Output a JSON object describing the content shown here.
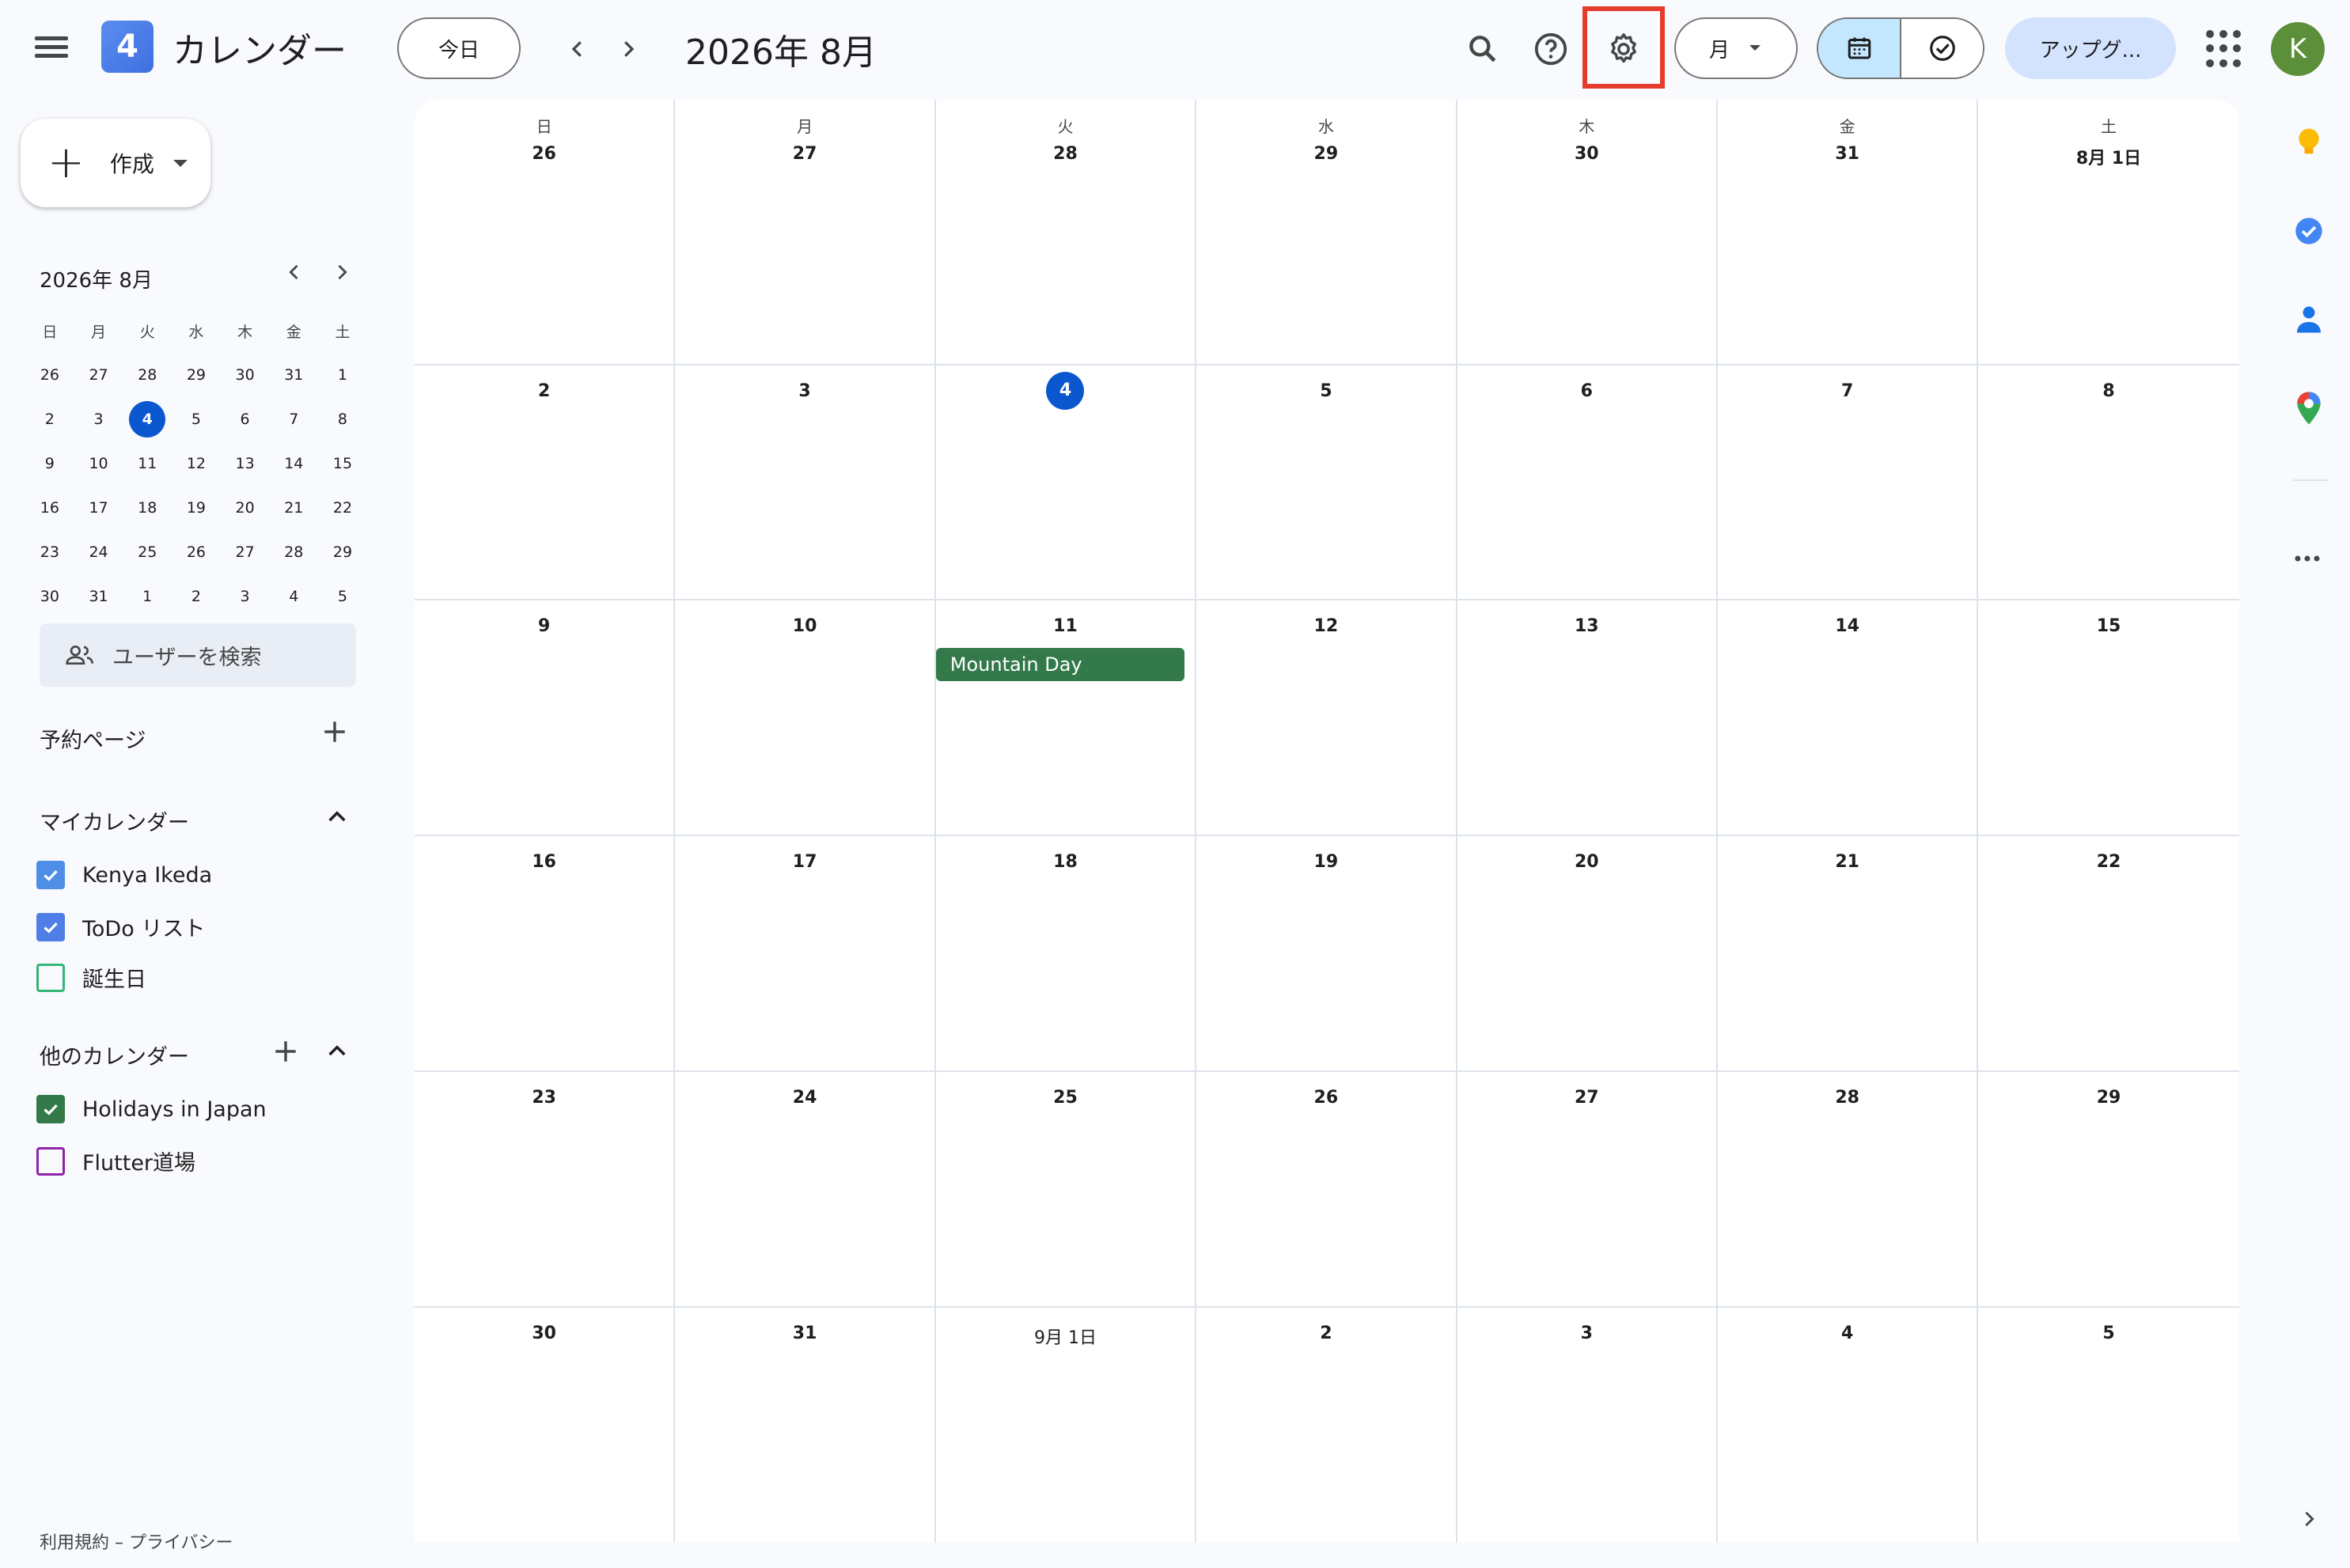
{
  "header": {
    "app_logo_number": "4",
    "app_title": "カレンダー",
    "today_label": "今日",
    "month_title": "2026年 8月",
    "view_label": "月",
    "upgrade_label": "アップグ...",
    "avatar_initial": "K"
  },
  "sidebar": {
    "create_label": "作成",
    "mini_calendar": {
      "title": "2026年 8月",
      "weekday_headers": [
        "日",
        "月",
        "火",
        "水",
        "木",
        "金",
        "土"
      ],
      "weeks": [
        [
          "26",
          "27",
          "28",
          "29",
          "30",
          "31",
          "1"
        ],
        [
          "2",
          "3",
          "4",
          "5",
          "6",
          "7",
          "8"
        ],
        [
          "9",
          "10",
          "11",
          "12",
          "13",
          "14",
          "15"
        ],
        [
          "16",
          "17",
          "18",
          "19",
          "20",
          "21",
          "22"
        ],
        [
          "23",
          "24",
          "25",
          "26",
          "27",
          "28",
          "29"
        ],
        [
          "30",
          "31",
          "1",
          "2",
          "3",
          "4",
          "5"
        ]
      ],
      "today": "4"
    },
    "search_users_placeholder": "ユーザーを検索",
    "booking_pages_label": "予約ページ",
    "my_calendars_label": "マイカレンダー",
    "my_calendars": [
      {
        "name": "Kenya Ikeda",
        "checked": true,
        "color": "#4f8ee6"
      },
      {
        "name": "ToDo リスト",
        "checked": true,
        "color": "#4f7ee6"
      },
      {
        "name": "誕生日",
        "checked": false,
        "color": "#33b679"
      }
    ],
    "other_calendars_label": "他のカレンダー",
    "other_calendars": [
      {
        "name": "Holidays in Japan",
        "checked": true,
        "color": "#33794a"
      },
      {
        "name": "Flutter道場",
        "checked": false,
        "color": "#8e24aa"
      }
    ],
    "footer": "利用規約 – プライバシー"
  },
  "main": {
    "weekdays": [
      "日",
      "月",
      "火",
      "水",
      "木",
      "金",
      "土"
    ],
    "weeks": [
      [
        "26",
        "27",
        "28",
        "29",
        "30",
        "31",
        "8月 1日"
      ],
      [
        "2",
        "3",
        "4",
        "5",
        "6",
        "7",
        "8"
      ],
      [
        "9",
        "10",
        "11",
        "12",
        "13",
        "14",
        "15"
      ],
      [
        "16",
        "17",
        "18",
        "19",
        "20",
        "21",
        "22"
      ],
      [
        "23",
        "24",
        "25",
        "26",
        "27",
        "28",
        "29"
      ],
      [
        "30",
        "31",
        "9月 1日",
        "2",
        "3",
        "4",
        "5"
      ]
    ],
    "today": "4",
    "event": {
      "title": "Mountain Day",
      "color": "#33794a"
    }
  }
}
